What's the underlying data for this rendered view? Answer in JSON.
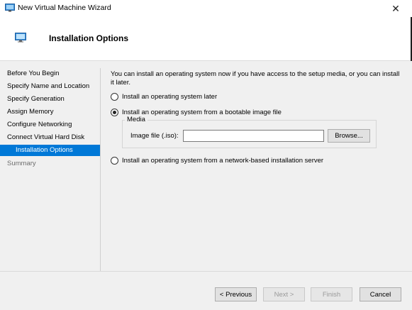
{
  "window": {
    "title": "New Virtual Machine Wizard",
    "close_glyph": "✕"
  },
  "header": {
    "title": "Installation Options",
    "icon": "virtual-machine-icon"
  },
  "sidebar": {
    "items": [
      {
        "label": "Before You Begin",
        "state": "normal"
      },
      {
        "label": "Specify Name and Location",
        "state": "normal"
      },
      {
        "label": "Specify Generation",
        "state": "normal"
      },
      {
        "label": "Assign Memory",
        "state": "normal"
      },
      {
        "label": "Configure Networking",
        "state": "normal"
      },
      {
        "label": "Connect Virtual Hard Disk",
        "state": "normal"
      },
      {
        "label": "Installation Options",
        "state": "active"
      },
      {
        "label": "Summary",
        "state": "disabled"
      }
    ]
  },
  "main": {
    "intro": "You can install an operating system now if you have access to the setup media, or you can install it later.",
    "options": {
      "later": {
        "label": "Install an operating system later",
        "selected": false
      },
      "bootable": {
        "label": "Install an operating system from a bootable image file",
        "selected": true
      },
      "network": {
        "label": "Install an operating system from a network-based installation server",
        "selected": false
      }
    },
    "media": {
      "legend": "Media",
      "image_label": "Image file (.iso):",
      "image_value": "",
      "browse_label": "Browse..."
    }
  },
  "footer": {
    "previous_label": "< Previous",
    "next_label": "Next >",
    "finish_label": "Finish",
    "cancel_label": "Cancel"
  },
  "colors": {
    "accent": "#0078d7",
    "disabled_text": "#9a9a9a"
  }
}
